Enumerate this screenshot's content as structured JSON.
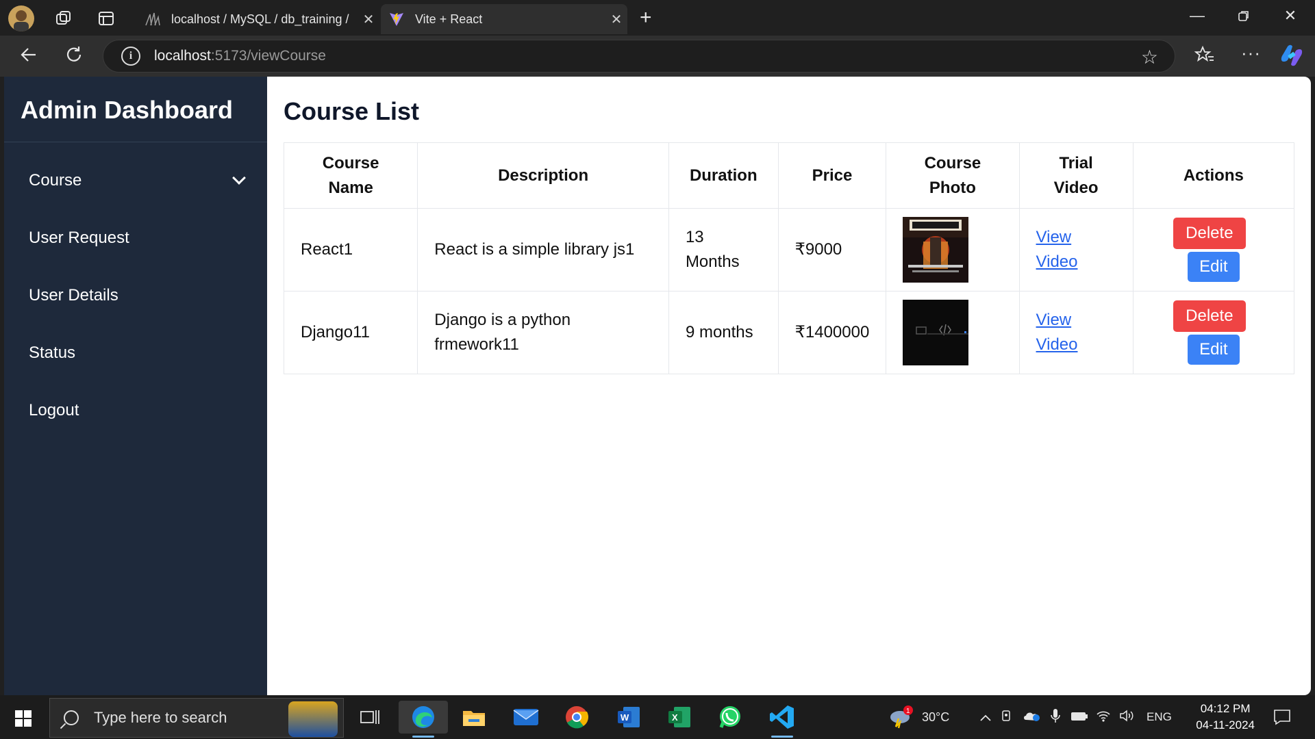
{
  "browser": {
    "tabs": [
      {
        "title": "localhost / MySQL / db_training /",
        "active": false
      },
      {
        "title": "Vite + React",
        "active": true
      }
    ],
    "url_host": "localhost",
    "url_path": ":5173/viewCourse"
  },
  "sidebar": {
    "brand": "Admin Dashboard",
    "items": [
      {
        "label": "Course",
        "has_dropdown": true
      },
      {
        "label": "User Request"
      },
      {
        "label": "User Details"
      },
      {
        "label": "Status"
      },
      {
        "label": "Logout"
      }
    ]
  },
  "main": {
    "title": "Course List",
    "columns": [
      "Course Name",
      "Description",
      "Duration",
      "Price",
      "Course Photo",
      "Trial Video",
      "Actions"
    ],
    "rows": [
      {
        "name": "React1",
        "description": "React is a simple library js1",
        "duration": "13 Months",
        "price": "₹9000",
        "video_line1": "View",
        "video_line2": "Video",
        "delete_label": "Delete",
        "edit_label": "Edit"
      },
      {
        "name": "Django11",
        "description": "Django is a python frmework11",
        "duration": "9 months",
        "price": "₹1400000",
        "video_line1": "View",
        "video_line2": "Video",
        "delete_label": "Delete",
        "edit_label": "Edit"
      }
    ]
  },
  "taskbar": {
    "search_placeholder": "Type here to search",
    "weather": "30°C",
    "language": "ENG",
    "time": "04:12 PM",
    "date": "04-11-2024",
    "weather_badge": "1"
  },
  "colors": {
    "sidebar_bg": "#1e293b",
    "delete": "#ef4444",
    "edit": "#3b82f6",
    "link": "#2563eb"
  }
}
